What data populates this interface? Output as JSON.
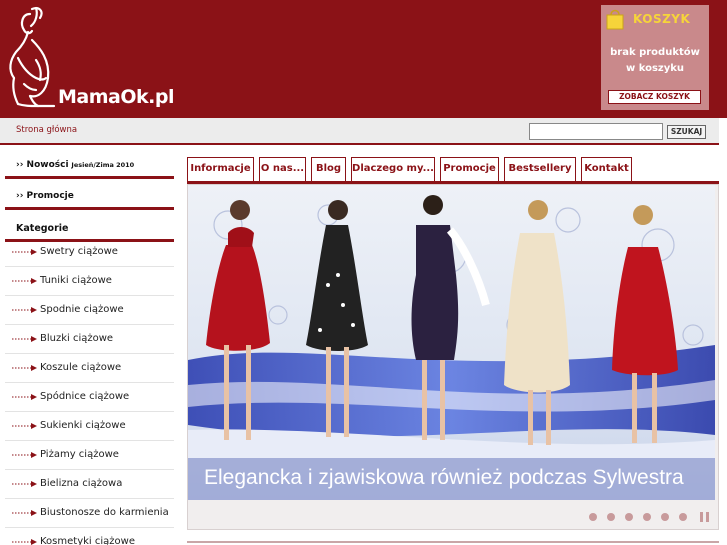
{
  "site": {
    "logo_text": "MamaOk.pl"
  },
  "cart": {
    "title": "KOSZYK",
    "empty_text": "brak produktów w koszyku",
    "view_button": "ZOBACZ KOSZYK",
    "icon": "shopping-bag-icon"
  },
  "breadcrumb": {
    "home": "Strona główna"
  },
  "search": {
    "button": "SZUKAJ",
    "placeholder": ""
  },
  "sidebar": {
    "nowosci": {
      "label": "›› Nowości",
      "sub": "Jesień/Zima 2010"
    },
    "promocje": {
      "label": "›› Promocje"
    },
    "categories_title": "Kategorie",
    "categories": [
      "Swetry ciążowe",
      "Tuniki ciążowe",
      "Spodnie ciążowe",
      "Bluzki ciążowe",
      "Koszule ciążowe",
      "Spódnice ciążowe",
      "Sukienki ciążowe",
      "Piżamy ciążowe",
      "Bielizna ciążowa",
      "Biustonosze do karmienia",
      "Kosmetyki ciążowe"
    ]
  },
  "tabs": [
    "Informacje",
    "O nas...",
    "Blog",
    "Dlaczego my...",
    "Promocje",
    "Bestsellery",
    "Kontakt"
  ],
  "banner": {
    "caption": "Elegancka i zjawiskowa również podczas Sylwestra",
    "slides": 6
  },
  "colors": {
    "brand": "#8b1217",
    "cart_bg": "#c9898b",
    "cart_title": "#f6d43a"
  }
}
